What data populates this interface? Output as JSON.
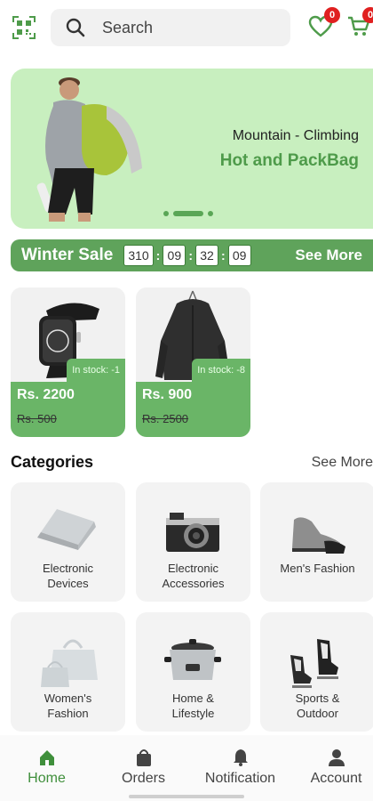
{
  "header": {
    "search_placeholder": "Search",
    "wishlist_count": "0",
    "cart_count": "0"
  },
  "hero": {
    "subtitle": "Mountain - Climbing",
    "title": "Hot and PackBag",
    "active_slide": 1,
    "slides": 3
  },
  "sale": {
    "title": "Winter Sale",
    "timer": [
      "310",
      "09",
      "32",
      "09"
    ],
    "see_more": "See More"
  },
  "products": [
    {
      "name": "watch",
      "stock": "In stock: -1",
      "price": "Rs. 2200",
      "old_price": "Rs. 500"
    },
    {
      "name": "jacket",
      "stock": "In stock: -8",
      "price": "Rs. 900",
      "old_price": "Rs. 2500"
    }
  ],
  "categories": {
    "title": "Categories",
    "see_more": "See More",
    "items": [
      {
        "label": "Electronic\nDevices",
        "icon": "laptop-icon"
      },
      {
        "label": "Electronic\nAccessories",
        "icon": "camera-icon"
      },
      {
        "label": "Men's Fashion",
        "icon": "sneaker-icon"
      },
      {
        "label": "Women's\nFashion",
        "icon": "handbag-icon"
      },
      {
        "label": "Home &\nLifestyle",
        "icon": "cooker-icon"
      },
      {
        "label": "Sports &\nOutdoor",
        "icon": "skates-icon"
      }
    ]
  },
  "nav": {
    "items": [
      {
        "label": "Home",
        "icon": "home-icon",
        "active": true
      },
      {
        "label": "Orders",
        "icon": "bag-icon",
        "active": false
      },
      {
        "label": "Notification",
        "icon": "bell-icon",
        "active": false
      },
      {
        "label": "Account",
        "icon": "person-icon",
        "active": false
      }
    ]
  },
  "colors": {
    "accent": "#5fa35b",
    "hero_bg": "#c8efbf",
    "badge": "#e02020"
  }
}
